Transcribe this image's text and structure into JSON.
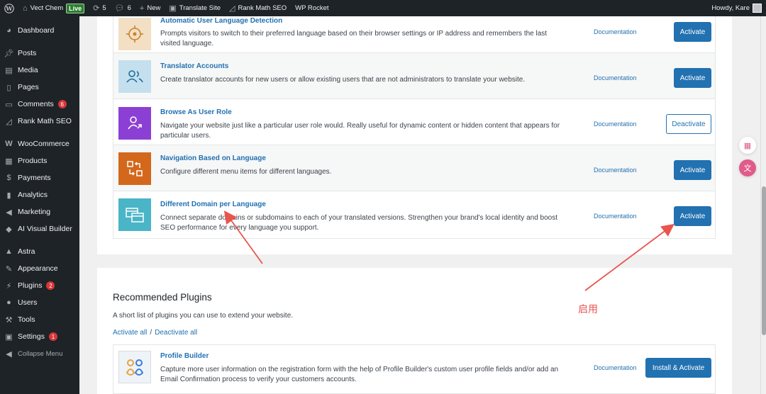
{
  "adminbar": {
    "site_name": "Vect Chem",
    "live_badge": "Live",
    "updates_count": "5",
    "comments_count": "6",
    "new_label": "New",
    "translate_label": "Translate Site",
    "rankmath_label": "Rank Math SEO",
    "wprocket_label": "WP Rocket",
    "howdy": "Howdy, Kare"
  },
  "sidebar": {
    "items": [
      {
        "label": "Dashboard",
        "icon": "dashboard-icon"
      },
      {
        "label": "Posts",
        "icon": "pin-icon"
      },
      {
        "label": "Media",
        "icon": "media-icon"
      },
      {
        "label": "Pages",
        "icon": "pages-icon"
      },
      {
        "label": "Comments",
        "icon": "comment-icon",
        "count": "6"
      },
      {
        "label": "Rank Math SEO",
        "icon": "chart-icon"
      },
      {
        "label": "WooCommerce",
        "icon": "woo-icon"
      },
      {
        "label": "Products",
        "icon": "box-icon"
      },
      {
        "label": "Payments",
        "icon": "dollar-icon"
      },
      {
        "label": "Analytics",
        "icon": "bar-chart-icon"
      },
      {
        "label": "Marketing",
        "icon": "megaphone-icon"
      },
      {
        "label": "AI Visual Builder",
        "icon": "ai-icon"
      },
      {
        "label": "Astra",
        "icon": "astra-icon"
      },
      {
        "label": "Appearance",
        "icon": "brush-icon"
      },
      {
        "label": "Plugins",
        "icon": "plug-icon",
        "count": "2"
      },
      {
        "label": "Users",
        "icon": "user-icon"
      },
      {
        "label": "Tools",
        "icon": "wrench-icon"
      },
      {
        "label": "Settings",
        "icon": "settings-icon",
        "count": "1"
      }
    ],
    "collapse_label": "Collapse Menu"
  },
  "addons": [
    {
      "title": "Automatic User Language Detection",
      "desc": "Prompts visitors to switch to their preferred language based on their browser settings or IP address and remembers the last visited language.",
      "doc": "Documentation",
      "button": "Activate",
      "icon_color": "#f2dfc4"
    },
    {
      "title": "Translator Accounts",
      "desc": "Create translator accounts for new users or allow existing users that are not administrators to translate your website.",
      "doc": "Documentation",
      "button": "Activate",
      "icon_color": "#c4e0ee"
    },
    {
      "title": "Browse As User Role",
      "desc": "Navigate your website just like a particular user role would. Really useful for dynamic content or hidden content that appears for particular users.",
      "doc": "Documentation",
      "button": "Deactivate",
      "icon_color": "#8c3fd4"
    },
    {
      "title": "Navigation Based on Language",
      "desc": "Configure different menu items for different languages.",
      "doc": "Documentation",
      "button": "Activate",
      "icon_color": "#d3681c"
    },
    {
      "title": "Different Domain per Language",
      "desc": "Connect separate domains or subdomains to each of your translated versions. Strengthen your brand's local identity and boost SEO performance for every language you support.",
      "doc": "Documentation",
      "button": "Activate",
      "icon_color": "#49b5c7"
    }
  ],
  "recommended": {
    "title": "Recommended Plugins",
    "subtitle": "A short list of plugins you can use to extend your website.",
    "activate_all": "Activate all",
    "separator": "/",
    "deactivate_all": "Deactivate all",
    "plugin": {
      "title": "Profile Builder",
      "desc": "Capture more user information on the registration form with the help of Profile Builder's custom user profile fields and/or add an Email Confirmation process to verify your customers accounts.",
      "doc": "Documentation",
      "button": "Install & Activate"
    }
  },
  "annotation": {
    "text": "启用",
    "color": "#e8554e"
  }
}
